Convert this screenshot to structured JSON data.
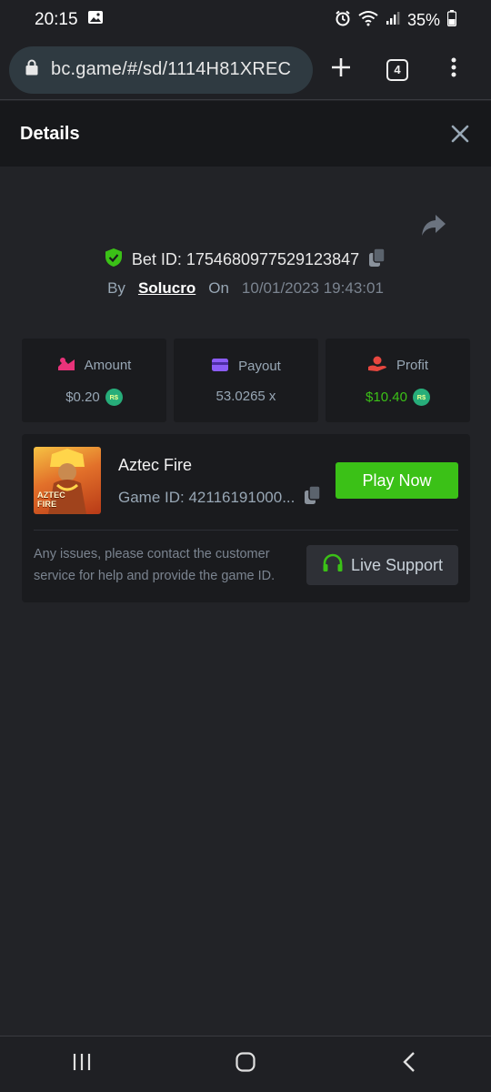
{
  "status_bar": {
    "time": "20:15",
    "battery": "35%",
    "icons": [
      "image-icon",
      "alarm-icon",
      "wifi-icon",
      "signal-icon",
      "battery-icon"
    ]
  },
  "browser": {
    "url": "bc.game/#/sd/1114H81XREC",
    "tab_count": "4",
    "icons": [
      "lock-icon",
      "plus-icon",
      "tabs-icon",
      "menu-dots-icon"
    ]
  },
  "header": {
    "title": "Details"
  },
  "bet": {
    "id_label": "Bet ID: 1754680977529123847",
    "by_label": "By",
    "user": "Solucro",
    "on_label": "On",
    "date": "10/01/2023 19:43:01"
  },
  "stats": [
    {
      "label": "Amount",
      "value": "$0.20",
      "icon": "amount-icon",
      "color": "#e8337a",
      "coin": "R$"
    },
    {
      "label": "Payout",
      "value": "53.0265 x",
      "icon": "payout-card-icon",
      "color": "#8b5cf6"
    },
    {
      "label": "Profit",
      "value": "$10.40",
      "icon": "profit-hand-icon",
      "color": "#e8473f",
      "coin": "R$"
    }
  ],
  "game": {
    "name": "Aztec Fire",
    "game_id": "Game ID: 42116191000...",
    "thumb_text_1": "AZTEC",
    "thumb_text_2": "FIRE",
    "play_label": "Play Now"
  },
  "support": {
    "text": "Any issues, please contact the customer service for help and provide the game ID.",
    "button_label": "Live Support"
  },
  "colors": {
    "accent_green": "#3bc117",
    "bg": "#222327",
    "card": "#1a1b1e",
    "muted": "#98a7b5"
  }
}
